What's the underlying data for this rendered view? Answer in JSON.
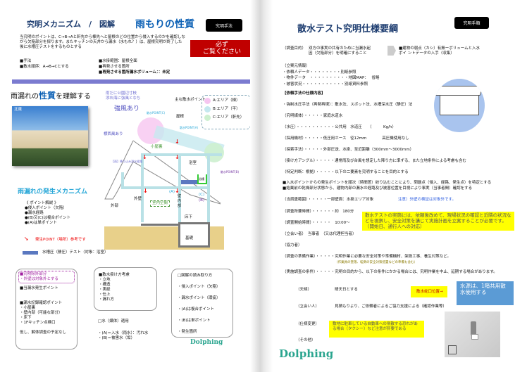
{
  "left": {
    "title": "究明メカニズム　/　図解",
    "title_accent": "雨もりの性質",
    "method_button": "究明手法",
    "intro": "当究明のポイントは、C→B→Aと軒先から棟先へと屋根のどの位置から侵入するのかを確認しながら欠陥部分を探ります。またキッチンの天井から漏水（水もれ？）は、屋根究明が終了した後に水槽圧テストをするものとする",
    "must_read": [
      "必ず",
      "ご覧ください"
    ],
    "specs": [
      "■手法",
      "■散水順序：A→B→Cとする",
      "■水掛範囲：屋根全面",
      "■再発させる箇所",
      "■再発させる箇所漏水ボリューム：：未定"
    ],
    "understand_prefix": "雨漏れの",
    "understand_accent": "性質",
    "understand_suffix": "を理解する",
    "photo_label": "北東",
    "diagram": {
      "wind_note": [
        "雨だに公園辺寸枝",
        "添右海に強風となち"
      ],
      "strong_wind": "強風あり",
      "side_wind": "横西風あり",
      "points_label": "主な散水ポイント",
      "point_c": "散水POINT(C)",
      "point_a": "散水POINT(A)",
      "point_b": "散水POINT(B)",
      "roof": "屋根",
      "attic": "小屋裏",
      "bath": "浴室",
      "tub": "浴槽",
      "leak_path": "【雨】降り込み浸水経路",
      "outer_wall": "外壁",
      "exterior": "外部",
      "indoor": "室内空間",
      "wall_inner": "壁内部",
      "underfloor": "床下",
      "foundation": "基礎",
      "mark_a": "(A)",
      "mark_c": "(C)",
      "mark_b": "(B)",
      "legend": [
        "A:エリア（棟）",
        "B:エリア（平）",
        "C:エリア（軒先）"
      ],
      "legend_colors": [
        "#f6c6f0",
        "#c5e8ef",
        "#cdf0cf"
      ]
    },
    "mechanism_title": "雨漏れの発生メカニズム",
    "points_title": "《 ポイント解説 》",
    "points": [
      "●侵入ポイント（欠陥）",
      "●漏水経路",
      "●(B)又(C)は複合ポイント",
      "●(A)は単ポイント"
    ],
    "occurrence": "発生POINT（場所）参考です",
    "pressure_test": "水槽圧（静圧）テスト（対象：浴室）",
    "box1": {
      "excluded": [
        "■究明除外部分",
        "・外壁は対象外とする"
      ],
      "items": [
        "■当漏水発生ポイント",
        "",
        "■漏水記録確認ポイント",
        "・小屋裏",
        "・壁内部（可能な部分）",
        "・床下",
        "・1Fキッチン点検口",
        "",
        "但し、解体調査の予定なし"
      ]
    },
    "box2": {
      "items": [
        "■散水掛け方考慮",
        "・立地",
        "・構造",
        "・実経",
        "・仕上",
        "・漏れ方"
      ]
    },
    "water": {
      "items": [
        "□水（媒体）適用",
        "",
        "・(A)＝入水（雨水）：汚れ水",
        "・(B)＝被害水（垢）"
      ]
    },
    "box3": {
      "items": [
        "□図解の読み取り方",
        "",
        "・侵入ポイント（欠陥）",
        "",
        "・漏水ポイント（瑕疵）",
        "",
        "・(A)は複合ポイント",
        "",
        "・(B)は単ポイント",
        "",
        "・発生箇所"
      ]
    },
    "logo": "Dolphing"
  },
  "right": {
    "title": "散水テスト究明仕様要綱",
    "procedure_button": "究明手順",
    "purpose_label": "（調査目的）",
    "purpose": [
      "双方の事実の共有のために当漏水起",
      "因（欠陥部分）を明確にすること"
    ],
    "purpose_result": [
      "■建物の弱点（カシ）有無ーボリュームと入水",
      "ポイ ントデータの入手（収集）"
    ],
    "info": [
      "（立案元情報）",
      "・依頼人データ・・・・・・・・別紙参照",
      "・物件データ　・・・・・・・・・・地図MAP：　 省略",
      "・被害状況・・・・・・・・・・・別紙資料参照"
    ],
    "spec_title": "【依頼手法の仕様内容】",
    "spec": [
      "・強制水圧手法（再発再現）：散水法、スポット法、水槽深水圧（静圧）法",
      "（究明媒体）・・・・・家庭水道水",
      "（水圧）・・・・・・・・・・公共用　水道圧　　（　　　Kg/h）",
      "（採用機材）・・・・・低圧用ホース　径12mm　　　　高圧機使用なし",
      "（探索手法）・・・・・外部圧送、水掛、至近距離（300mm〜3000mm）",
      "（掛け方アングル）・・・・・通常雨及び台風を想定した降り方に準ずる、また立地条件による考慮も含む",
      "（特定判断：根拠）・・・・・以下の二要素を究明することを目的とする"
    ],
    "bullets": [
      "■入水ポイントからの発生ポイントを順次（時間差）絞り込むことにより、問題点（侵入、経路、発生点）を特定とする",
      "■始業前の乾燥部分状態から、建物内部の漏水の経路及び被害位置を目視により事実（当事者間）確認をする"
    ],
    "scope": "（当調査範囲）・・・・・一部壁面：水掛エリア対象",
    "scope_note": "注意）外壁の検証は対象外です。",
    "duration": "（調査所要時間）・・・・・・約　180分",
    "start": "（調査開始時間）・・・・・　10:00〜",
    "attendee": "（立会い者）　当事者　（又は代理担当者）",
    "cooperator": "（協力者）",
    "prep": "（調査の準備作業）・・・・・究明作業に必要な安全対策や準備機材、架設工事、養生対策など。",
    "prep_note": "（作業員の墜落、転倒の安全対策措置などの準備も含む）",
    "condition": "（実施調査の条件）・・・・・究明の目的から、以下の条件にかかる場合には、究明作業を中止、延期する場合があります。",
    "yellow_note": "散水テストの実施には、依頼後改めて、現場状況の確認と近隣の状況などを視察し、安全対策を講じて実施計画を立案することが必要です。（開始日、通行人への対応）",
    "weather_label": "（天候）",
    "weather": "晴天日とする",
    "faucet": "散水蛇口位置→",
    "water_source": "水源は、1階共用散水使用する",
    "witness_label": "（立会い人）",
    "witness": "見積もりより、ご依頼者によるご協力支援による（確認作業等）",
    "change_label": "（仕様変更）",
    "change": "敷地に駐車している自動車への飛散する恐れがある場合（タクシー）など注意が肝要である",
    "other_label": "（その他）",
    "logo": "Dolphing"
  },
  "colors": {
    "navy": "#1a3a6e",
    "accent_blue": "#0a5fb4",
    "red": "#c00000",
    "purple": "#7b7bd0",
    "cyan": "#2aa8d8",
    "yellow": "#ffff00",
    "ground": "#e8d08a"
  }
}
